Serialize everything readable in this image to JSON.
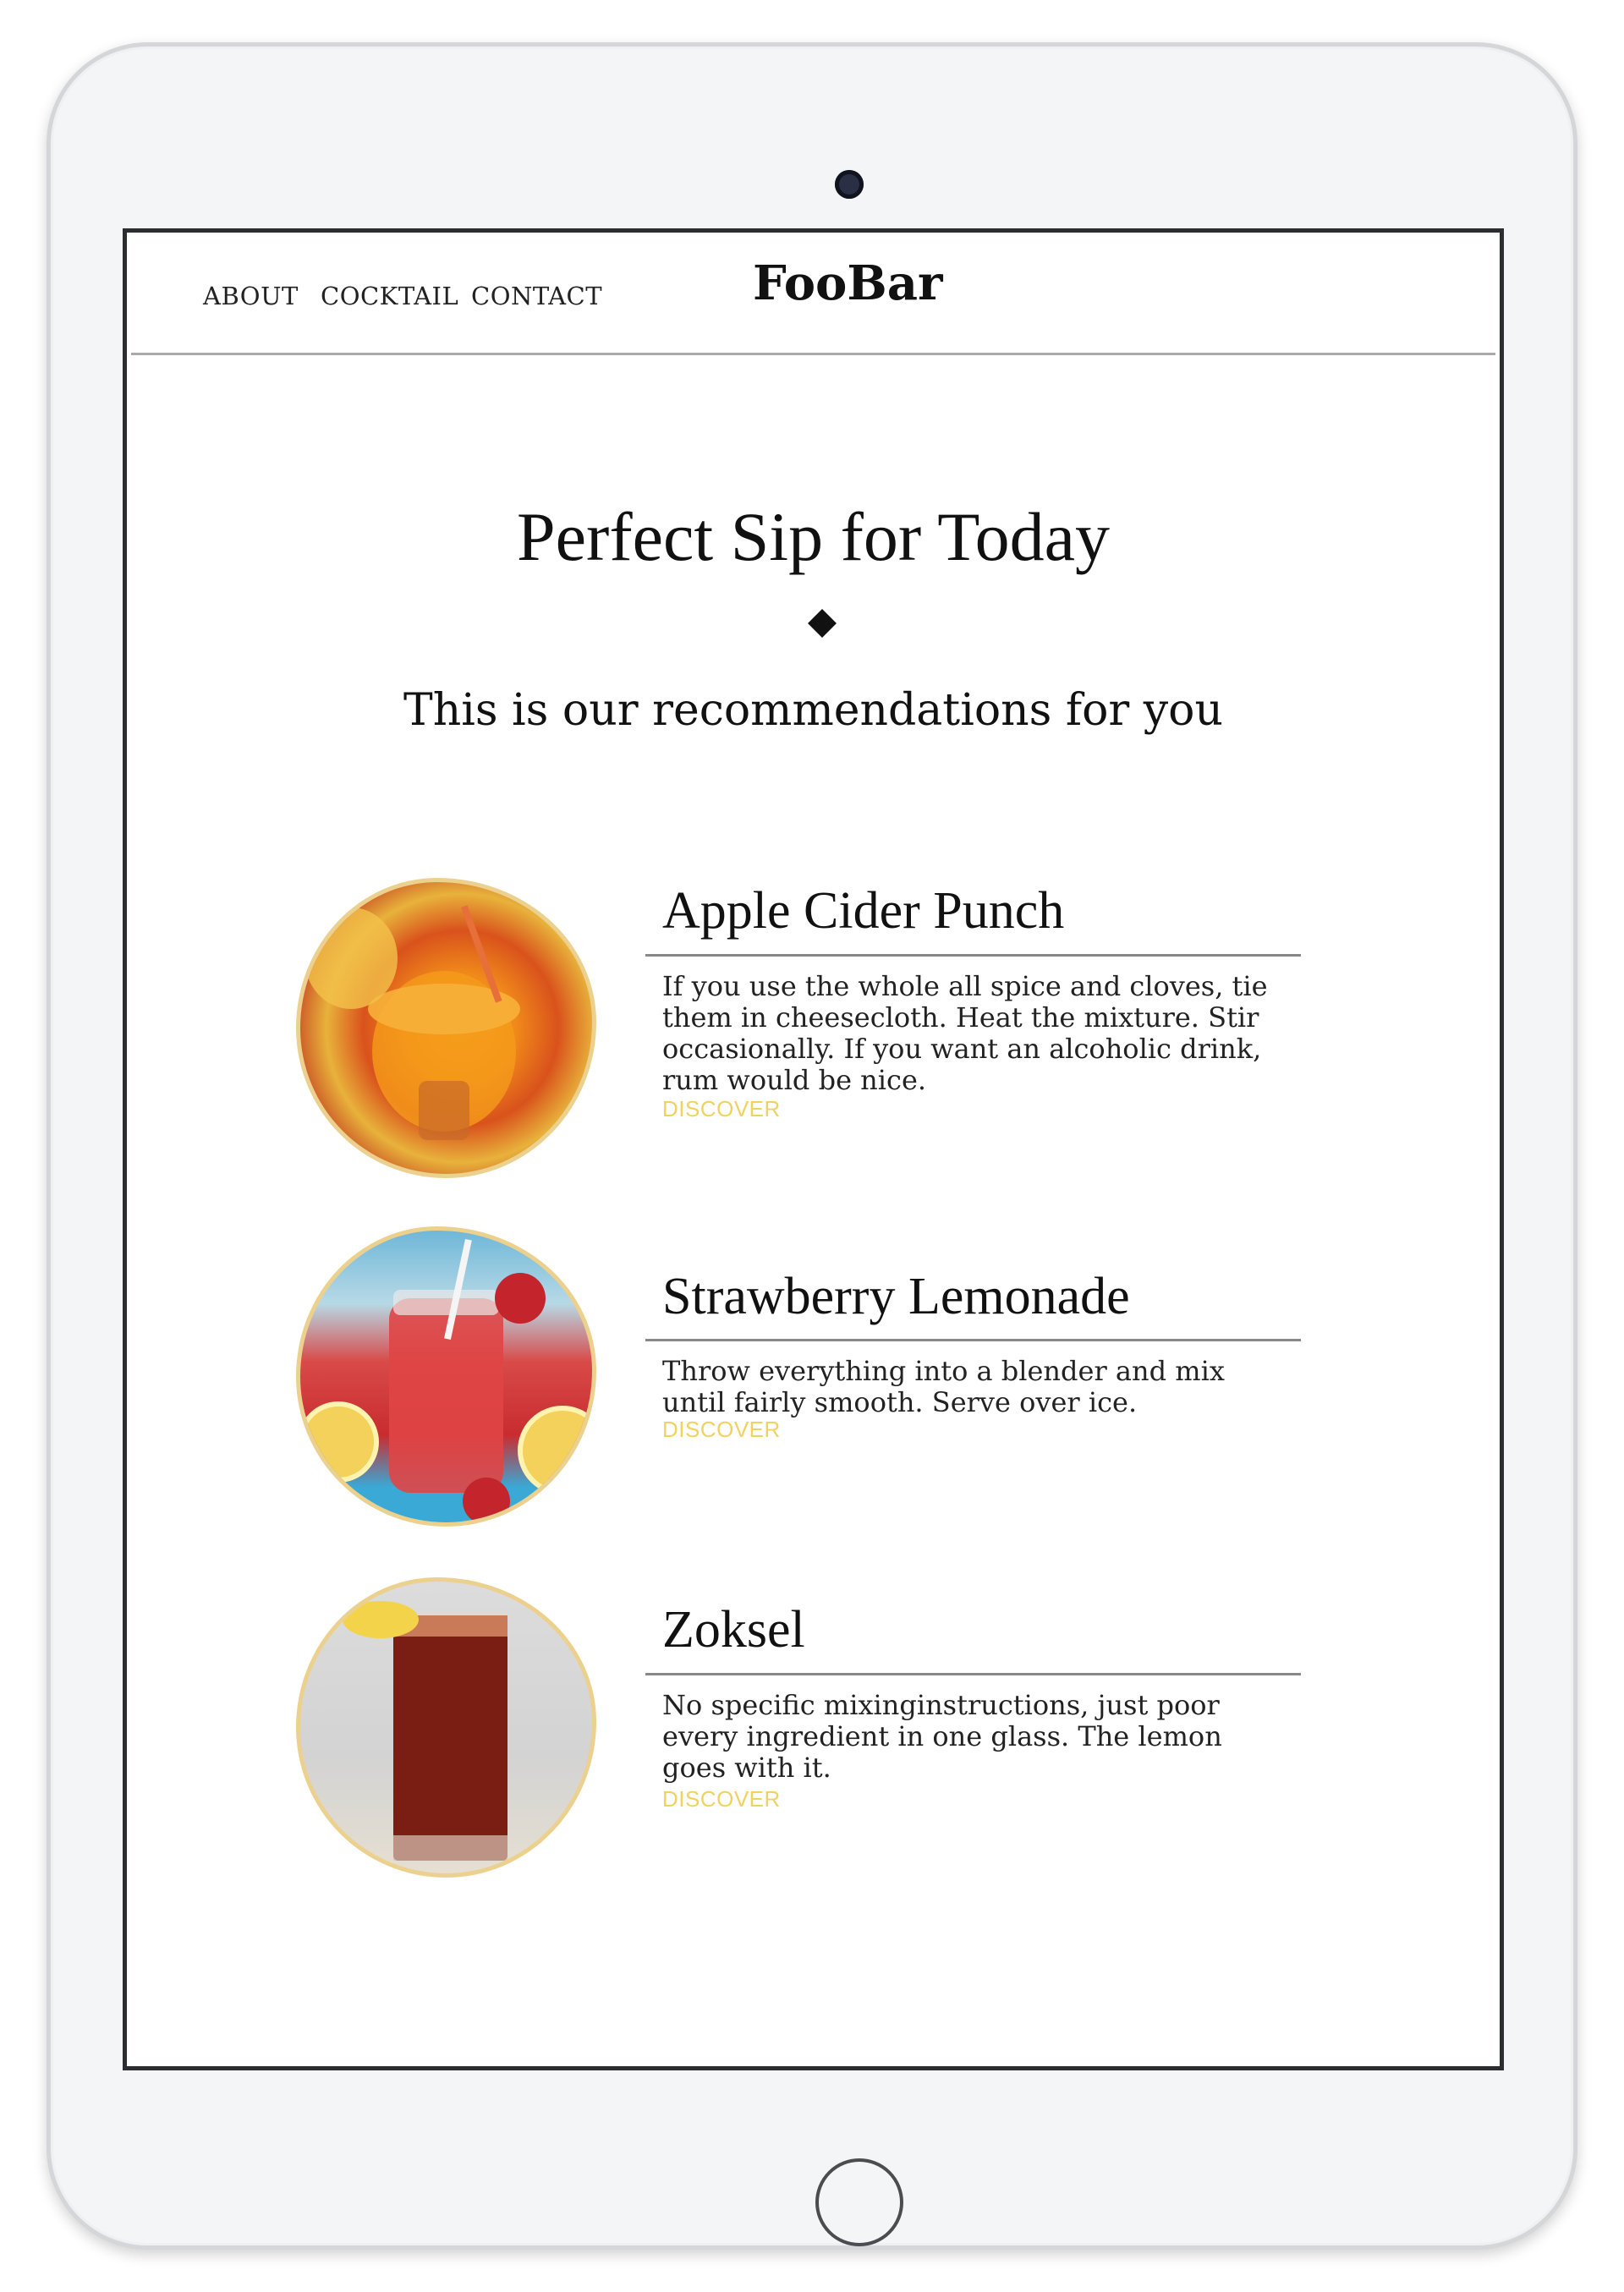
{
  "nav": {
    "links": [
      "ABOUT",
      "COCKTAIL",
      "CONTACT"
    ],
    "brand": "FooBar"
  },
  "hero": {
    "title": "Perfect Sip for Today",
    "subtitle": "This is our recommendations for you"
  },
  "cocktails": [
    {
      "title": "Apple Cider Punch",
      "description": "If you use the whole all spice and cloves, tie them in cheesecloth. Heat the mixture. Stir occasionally. If you want an alcoholic drink, rum would be nice.",
      "cta": "DISCOVER"
    },
    {
      "title": "Strawberry Lemonade",
      "description": "Throw everything into a blender and mix until fairly smooth. Serve over ice.",
      "cta": "DISCOVER"
    },
    {
      "title": "Zoksel",
      "description": "No specific mixinginstructions, just poor every ingredient in one glass. The lemon goes with it.",
      "cta": "DISCOVER"
    }
  ],
  "colors": {
    "accent": "#f2d25e",
    "image_border": "#ecd08e",
    "text": "#111111"
  }
}
